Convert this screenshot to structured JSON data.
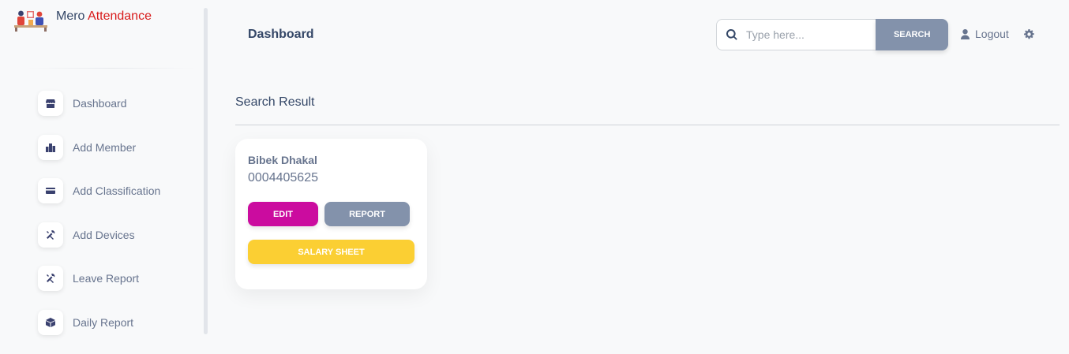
{
  "brand": {
    "name_part1": "Mero",
    "name_part2": "Attendance",
    "accent_color": "#d81b1b"
  },
  "sidebar": {
    "items": [
      {
        "label": "Dashboard",
        "icon": "shop-icon"
      },
      {
        "label": "Add Member",
        "icon": "office-icon"
      },
      {
        "label": "Add Classification",
        "icon": "credit-card-icon"
      },
      {
        "label": "Add Devices",
        "icon": "tools-icon"
      },
      {
        "label": "Leave Report",
        "icon": "tools-icon"
      },
      {
        "label": "Daily Report",
        "icon": "box-icon"
      }
    ]
  },
  "topbar": {
    "title": "Dashboard",
    "search_placeholder": "Type here...",
    "search_button": "SEARCH",
    "logout_label": "Logout"
  },
  "main": {
    "section_title": "Search Result",
    "result": {
      "name": "Bibek Dhakal",
      "id": "0004405625",
      "edit_label": "EDIT",
      "report_label": "REPORT",
      "salary_label": "SALARY SHEET"
    }
  },
  "colors": {
    "primary": "#cb0c9f",
    "secondary": "#8392ab",
    "warning": "#fbcf33",
    "text": "#344767"
  }
}
